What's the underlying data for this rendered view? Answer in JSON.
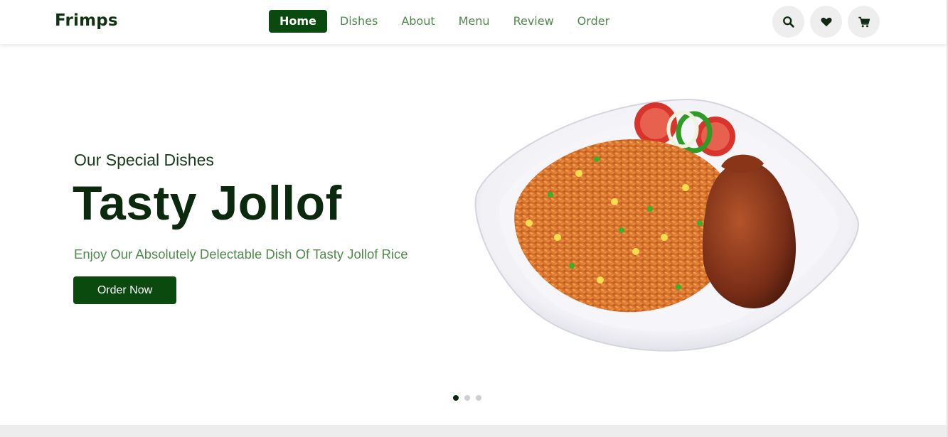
{
  "header": {
    "logo": "Frimps",
    "nav": [
      {
        "label": "Home",
        "active": true
      },
      {
        "label": "Dishes",
        "active": false
      },
      {
        "label": "About",
        "active": false
      },
      {
        "label": "Menu",
        "active": false
      },
      {
        "label": "Review",
        "active": false
      },
      {
        "label": "Order",
        "active": false
      }
    ],
    "icons": [
      "search-icon",
      "heart-icon",
      "cart-icon"
    ]
  },
  "hero": {
    "subtitle": "Our Special Dishes",
    "title": "Tasty Jollof",
    "tagline": "Enjoy Our Absolutely Delectable Dish Of Tasty Jollof Rice",
    "cta_label": "Order Now",
    "slides_total": 3,
    "active_slide": 1
  },
  "colors": {
    "brand_dark": "#0b4a0f",
    "title": "#0b2a0d",
    "accent_green": "#4f8a4a",
    "icon_bg": "#eeeeee"
  }
}
